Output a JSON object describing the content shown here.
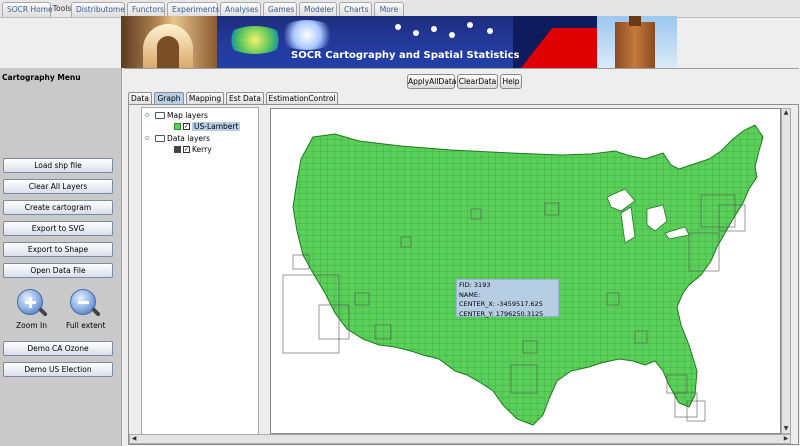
{
  "top_tabs": {
    "items": [
      "SOCR Home",
      "Tools",
      "Distributome",
      "Functors",
      "Experiments",
      "Analyses",
      "Games",
      "Modeler",
      "Charts",
      "More"
    ]
  },
  "banner": {
    "title": "SOCR Cartography and Spatial Statistics"
  },
  "left_panel": {
    "title": "Cartography Menu",
    "buttons": [
      "Load shp file",
      "Clear All Layers",
      "Create cartogram",
      "Export to SVG",
      "Export to Shape",
      "Open Data File"
    ],
    "tools": [
      {
        "label": "Zoom In",
        "icon": "zoom-in-icon"
      },
      {
        "label": "Full extent",
        "icon": "zoom-out-icon"
      }
    ],
    "demo_buttons": [
      "Demo CA Ozone",
      "Demo US Election"
    ]
  },
  "actions": {
    "apply_all": "ApplyAllData",
    "clear": "ClearData",
    "help": "Help"
  },
  "sub_tabs": {
    "items": [
      "Data",
      "Graph",
      "Mapping",
      "Est Data",
      "EstimationControl"
    ],
    "selected": "Graph"
  },
  "layers": {
    "map_group": "Map layers",
    "map_layer": "US-Lambert",
    "data_group": "Data layers",
    "data_layer": "Kerry"
  },
  "tooltip": {
    "fid": "FID: 3193",
    "name": "NAME:",
    "center_x": "CENTER_X: -3459517.625",
    "center_y": "CENTER_Y: 1796250.3125"
  },
  "colors": {
    "map_fill": "#5ad05a",
    "map_stroke": "#1f7a1f",
    "selected_row": "#b8cfe5"
  }
}
